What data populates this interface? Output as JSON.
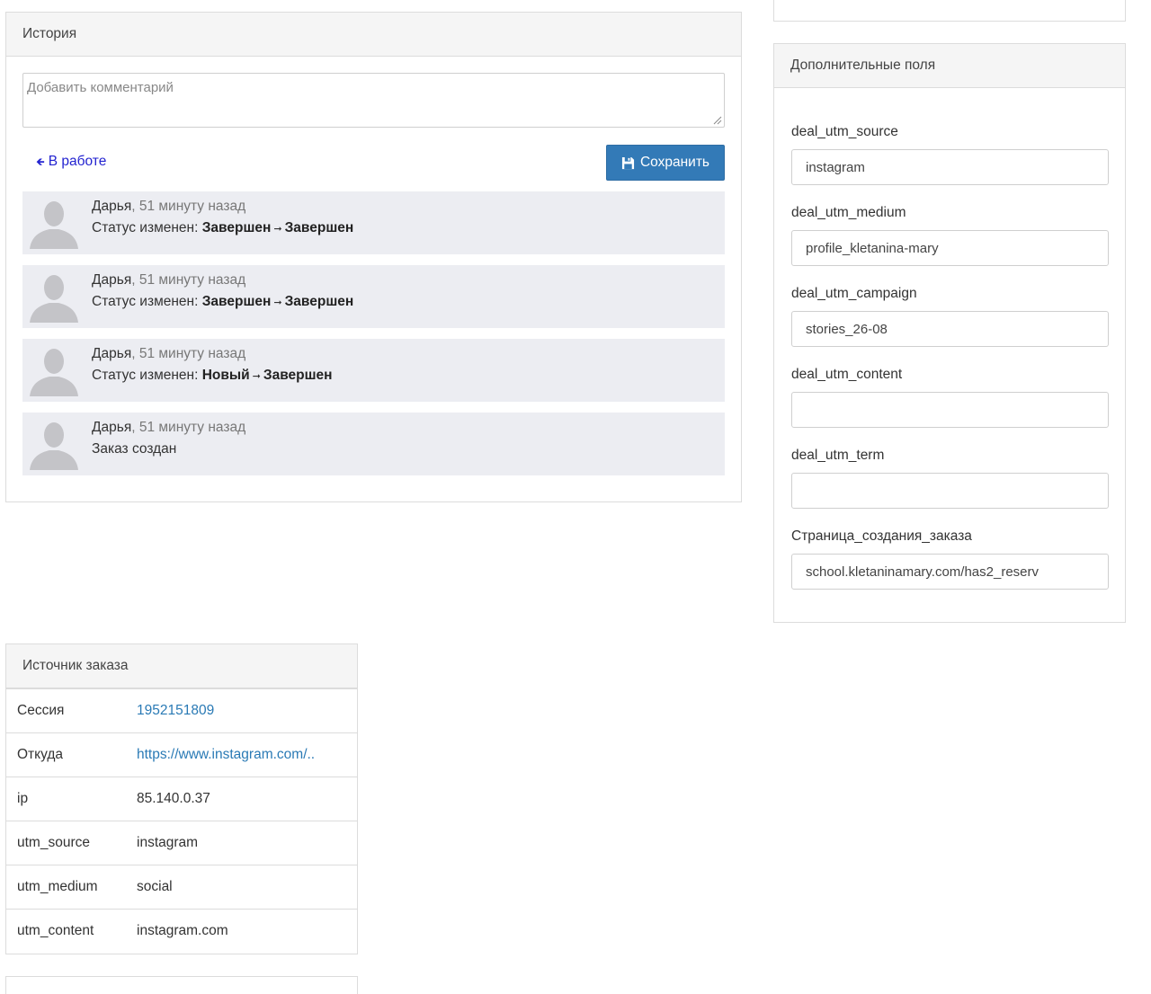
{
  "history": {
    "title": "История",
    "comment_placeholder": "Добавить комментарий",
    "status_link": "В работе",
    "save_label": "Сохранить",
    "entries": [
      {
        "author": "Дарья",
        "time": ", 51 минуту назад",
        "prefix": "Статус изменен: ",
        "from": "Завершен",
        "to": "Завершен"
      },
      {
        "author": "Дарья",
        "time": ", 51 минуту назад",
        "prefix": "Статус изменен: ",
        "from": "Завершен",
        "to": "Завершен"
      },
      {
        "author": "Дарья",
        "time": ", 51 минуту назад",
        "prefix": "Статус изменен: ",
        "from": "Новый",
        "to": "Завершен"
      },
      {
        "author": "Дарья",
        "time": ", 51 минуту назад",
        "text": "Заказ создан"
      }
    ]
  },
  "extra_fields": {
    "title": "Дополнительные поля",
    "fields": [
      {
        "label": "deal_utm_source",
        "value": "instagram"
      },
      {
        "label": "deal_utm_medium",
        "value": "profile_kletanina-mary"
      },
      {
        "label": "deal_utm_campaign",
        "value": "stories_26-08"
      },
      {
        "label": "deal_utm_content",
        "value": ""
      },
      {
        "label": "deal_utm_term",
        "value": ""
      },
      {
        "label": "Страница_создания_заказа",
        "value": "school.kletaninamary.com/has2_reserv"
      }
    ]
  },
  "source": {
    "title": "Источник заказа",
    "rows": [
      {
        "key": "Сессия",
        "value": "1952151809"
      },
      {
        "key": "Откуда",
        "value": "https://www.instagram.com/.."
      },
      {
        "key": "ip",
        "value": "85.140.0.37"
      },
      {
        "key": "utm_source",
        "value": "instagram"
      },
      {
        "key": "utm_medium",
        "value": "social"
      },
      {
        "key": "utm_content",
        "value": "instagram.com"
      }
    ]
  },
  "colors": {
    "primary_button": "#337ab7",
    "link": "#2a7ab5",
    "status_link": "#2323d0",
    "entry_background": "#ecedf2"
  },
  "icons": {
    "save": "floppy-disk-icon",
    "back": "left-arrow-icon",
    "avatar": "user-silhouette-icon"
  }
}
